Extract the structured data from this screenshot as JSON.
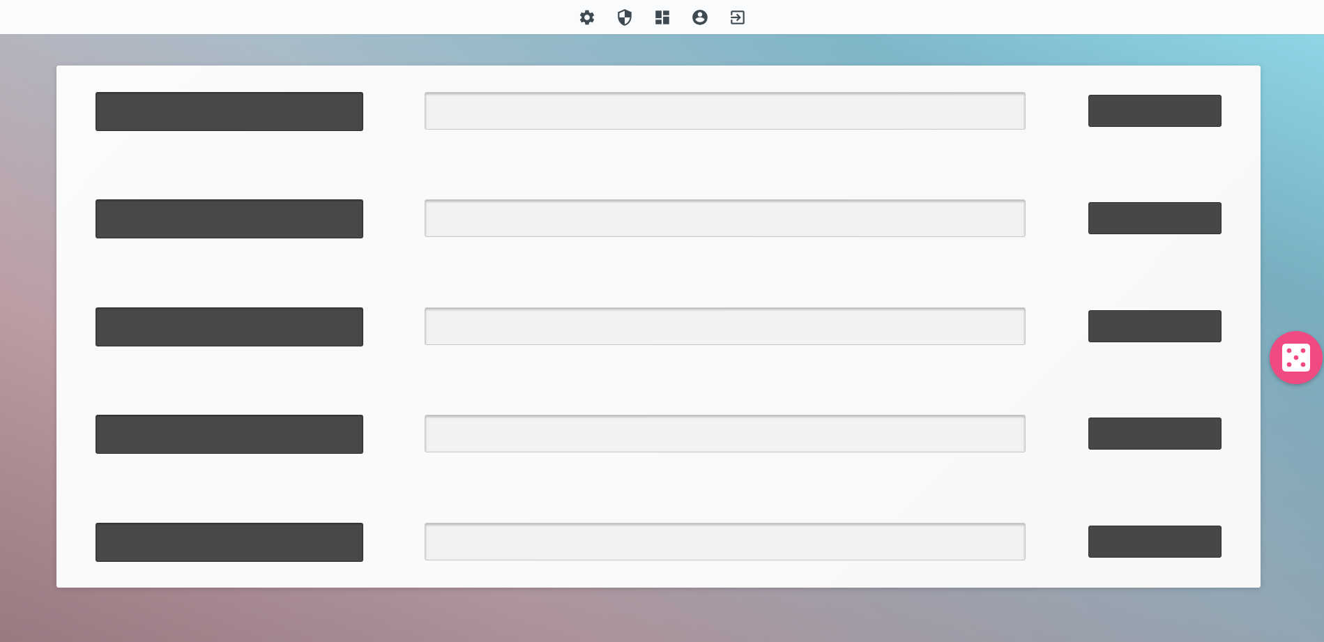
{
  "toolbar": {
    "icons": [
      "settings-icon",
      "shield-icon",
      "dashboard-icon",
      "account-icon",
      "logout-icon"
    ]
  },
  "rows": [
    {
      "label": "",
      "value": "",
      "button": ""
    },
    {
      "label": "",
      "value": "",
      "button": ""
    },
    {
      "label": "",
      "value": "",
      "button": ""
    },
    {
      "label": "",
      "value": "",
      "button": ""
    },
    {
      "label": "",
      "value": "",
      "button": ""
    }
  ],
  "fab": {
    "icon": "dice-icon"
  },
  "colors": {
    "accent": "#f04a83",
    "label_bg": "#484848",
    "field_bg": "#f1f2f3",
    "icon": "#3e4a52"
  }
}
